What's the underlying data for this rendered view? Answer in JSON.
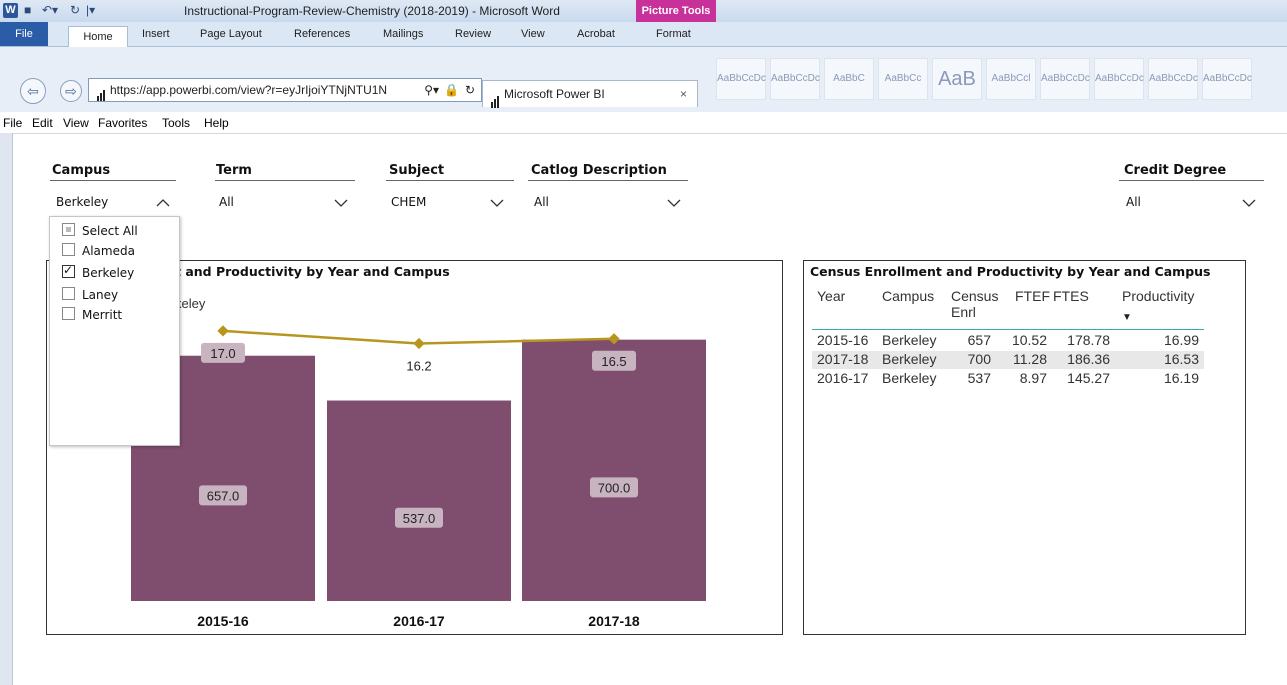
{
  "word": {
    "title": "Instructional-Program-Review-Chemistry (2018-2019)  -  Microsoft Word",
    "picture_tools": "Picture Tools",
    "tabs": [
      "File",
      "Home",
      "Insert",
      "Page Layout",
      "References",
      "Mailings",
      "Review",
      "View",
      "Acrobat",
      "Format"
    ]
  },
  "browser": {
    "url": "https://app.powerbi.com/view?r=eyJrIjoiYTNjNTU1N",
    "tab_title": "Microsoft Power BI",
    "tab_close": "×",
    "menu": [
      "File",
      "Edit",
      "View",
      "Favorites",
      "Tools",
      "Help"
    ]
  },
  "slicers": {
    "campus": {
      "title": "Campus",
      "value": "Berkeley"
    },
    "term": {
      "title": "Term",
      "value": "All"
    },
    "subject": {
      "title": "Subject",
      "value": "CHEM"
    },
    "catalog": {
      "title": "Catlog Description",
      "value": "All"
    },
    "credit": {
      "title": "Credit Degree",
      "value": "All"
    }
  },
  "dropdown": {
    "items": [
      {
        "label": "Select All",
        "state": "partial"
      },
      {
        "label": "Alameda",
        "state": "unchecked"
      },
      {
        "label": "Berkeley",
        "state": "checked"
      },
      {
        "label": "Laney",
        "state": "unchecked"
      },
      {
        "label": "Merritt",
        "state": "unchecked"
      }
    ]
  },
  "left_chart": {
    "title_visible": "t and Productivity by Year and Campus",
    "legend_visible": "keley"
  },
  "chart_data": {
    "type": "bar",
    "categories": [
      "2015-16",
      "2016-17",
      "2017-18"
    ],
    "series": [
      {
        "name": "",
        "kind": "bar",
        "values": [
          657.0,
          537.0,
          700.0
        ],
        "labels": [
          "657.0",
          "537.0",
          "700.0"
        ]
      },
      {
        "name": "",
        "kind": "line",
        "values": [
          17.0,
          16.2,
          16.5
        ],
        "labels": [
          "17.0",
          "16.2",
          "16.5"
        ]
      }
    ],
    "bar_color": "#7f4e6e",
    "line_color": "#b8961e",
    "ylim": [
      0,
      750
    ],
    "ylim_line": [
      0,
      18
    ]
  },
  "table": {
    "title": "Census Enrollment and Productivity by Year and Campus",
    "headers": [
      "Year",
      "Campus",
      "Census",
      "FTEF",
      "FTES",
      "Productivity"
    ],
    "header_sub": "Enrl",
    "rows": [
      [
        "2015-16",
        "Berkeley",
        "657",
        "10.52",
        "178.78",
        "16.99"
      ],
      [
        "2017-18",
        "Berkeley",
        "700",
        "11.28",
        "186.36",
        "16.53"
      ],
      [
        "2016-17",
        "Berkeley",
        "537",
        "8.97",
        "145.27",
        "16.19"
      ]
    ]
  }
}
